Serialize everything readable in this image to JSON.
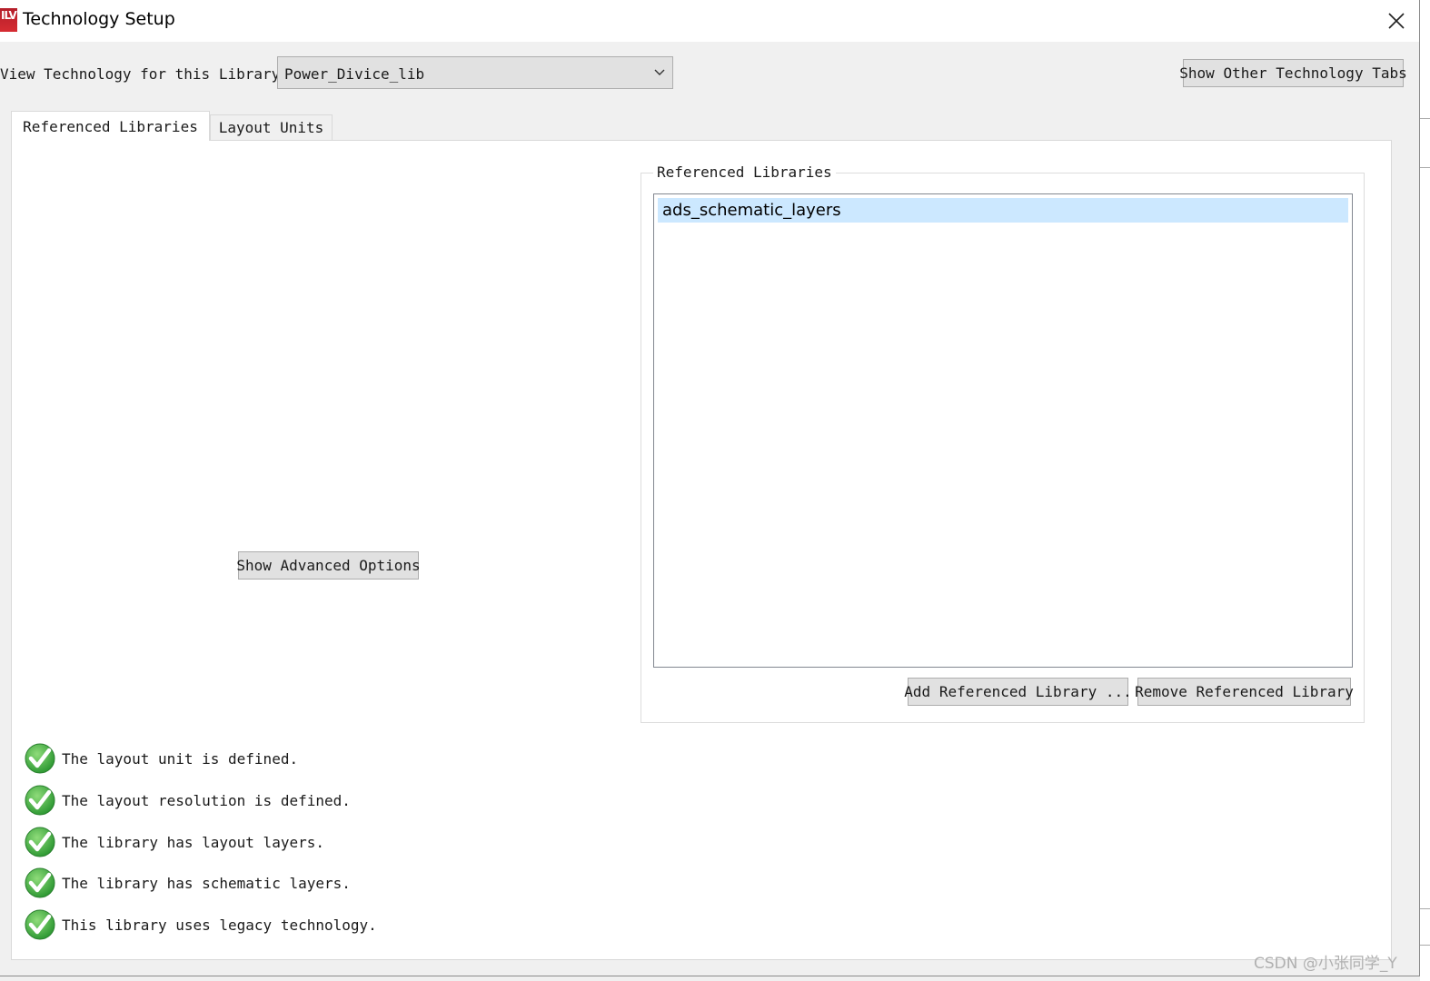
{
  "window": {
    "title": "Technology Setup",
    "icon_label": "ILV"
  },
  "library_row": {
    "label": "View Technology for this Library:",
    "selected_library": "Power_Divice_lib",
    "show_other_tabs_label": "Show Other Technology Tabs"
  },
  "tabs": [
    {
      "label": "Referenced Libraries",
      "active": true
    },
    {
      "label": "Layout Units",
      "active": false
    }
  ],
  "advanced": {
    "button_label": "Show Advanced Options"
  },
  "referenced_libraries": {
    "group_title": "Referenced Libraries",
    "items": [
      "ads_schematic_layers"
    ],
    "add_label": "Add Referenced Library ...",
    "remove_label": "Remove Referenced Library"
  },
  "status": [
    "The layout unit is defined.",
    "The layout resolution is defined.",
    "The library has layout layers.",
    "The library has schematic layers.",
    "This library uses legacy technology."
  ],
  "watermark": "CSDN @小张同学_Y",
  "colors": {
    "selection": "#cce8ff",
    "check_green": "#3aa53a",
    "app_icon_red": "#c8232c"
  }
}
